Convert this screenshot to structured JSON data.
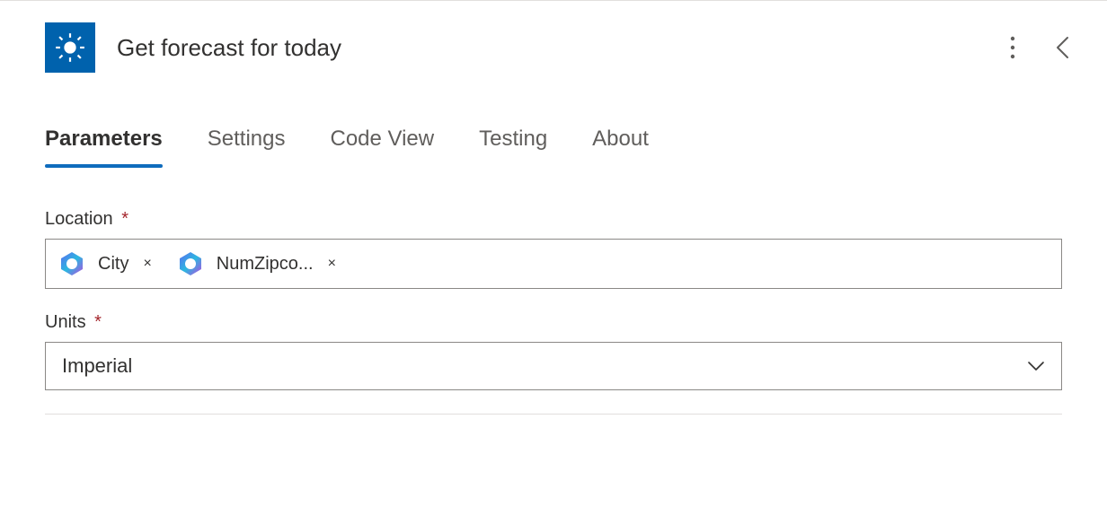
{
  "header": {
    "title": "Get forecast for today",
    "icon": "sun-icon"
  },
  "tabs": [
    {
      "label": "Parameters",
      "active": true
    },
    {
      "label": "Settings",
      "active": false
    },
    {
      "label": "Code View",
      "active": false
    },
    {
      "label": "Testing",
      "active": false
    },
    {
      "label": "About",
      "active": false
    }
  ],
  "fields": {
    "location": {
      "label": "Location",
      "required_mark": "*",
      "tokens": [
        {
          "label": "City"
        },
        {
          "label": "NumZipco..."
        }
      ],
      "remove_glyph": "×"
    },
    "units": {
      "label": "Units",
      "required_mark": "*",
      "value": "Imperial"
    }
  },
  "colors": {
    "connector": "#0062ad",
    "accent": "#0f6cbd",
    "required": "#a4262c"
  }
}
